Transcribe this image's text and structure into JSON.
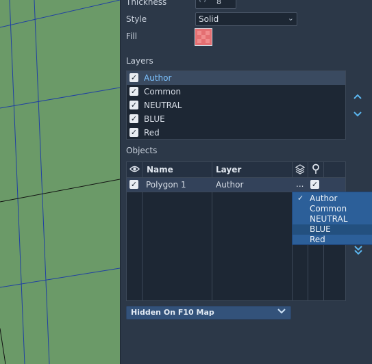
{
  "properties": {
    "thickness_label": "Thickness",
    "thickness_value": "8",
    "thickness_arrows": "‹ ›",
    "style_label": "Style",
    "style_value": "Solid",
    "fill_label": "Fill",
    "fill_color": "#e46f72"
  },
  "layers": {
    "section_label": "Layers",
    "items": [
      {
        "label": "Author",
        "checked": true,
        "selected": true
      },
      {
        "label": "Common",
        "checked": true
      },
      {
        "label": "NEUTRAL",
        "checked": true
      },
      {
        "label": "BLUE",
        "checked": true
      },
      {
        "label": "Red",
        "checked": true
      }
    ],
    "move_up_icon": "chevron-up-icon",
    "move_down_icon": "chevron-down-icon"
  },
  "objects": {
    "section_label": "Objects",
    "columns": {
      "visibility_icon": "eye-icon",
      "name": "Name",
      "layer": "Layer",
      "layers_icon": "layers-stack-icon",
      "pin_icon": "map-pin-icon"
    },
    "rows": [
      {
        "visible": true,
        "name": "Polygon 1",
        "layer": "Author",
        "more": "...",
        "pinned": true
      }
    ],
    "layer_menu": {
      "options": [
        "Author",
        "Common",
        "NEUTRAL",
        "BLUE",
        "Red"
      ],
      "checked": "Author",
      "highlighted": "BLUE"
    },
    "scroll_bottom_icon": "double-chevron-down-icon"
  },
  "map_visibility": {
    "value": "Hidden On F10 Map"
  }
}
